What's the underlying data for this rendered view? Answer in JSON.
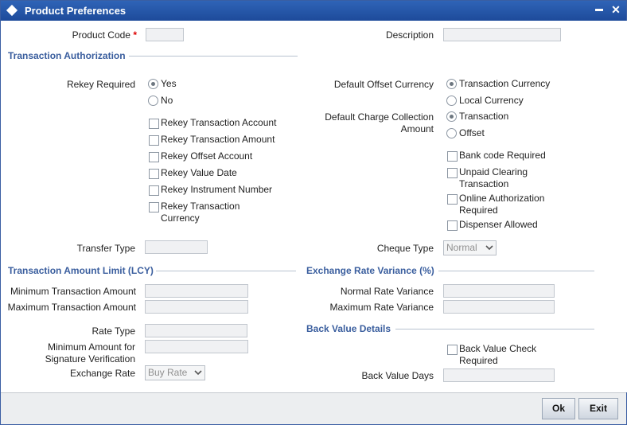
{
  "window": {
    "title": "Product Preferences",
    "minimize_glyph": "▬",
    "close_glyph": "✕"
  },
  "fields": {
    "product_code_label": "Product Code",
    "product_code_required": "*",
    "description_label": "Description",
    "transfer_type_label": "Transfer Type",
    "cheque_type_label": "Cheque Type",
    "cheque_type_value": "Normal"
  },
  "transaction_authorization": {
    "heading": "Transaction Authorization",
    "rekey_required_label": "Rekey Required",
    "rekey_yes": "Yes",
    "rekey_no": "No",
    "checkboxes": [
      "Rekey Transaction Account",
      "Rekey Transaction Amount",
      "Rekey Offset Account",
      "Rekey Value Date",
      "Rekey Instrument Number",
      "Rekey Transaction",
      "Currency"
    ]
  },
  "right_options": {
    "default_offset_currency_label": "Default Offset Currency",
    "offset_currency_options": [
      "Transaction Currency",
      "Local Currency"
    ],
    "default_charge_label_line1": "Default Charge Collection",
    "default_charge_label_line2": "Amount",
    "charge_options": [
      "Transaction",
      "Offset"
    ],
    "bank_code_required": "Bank code Required",
    "unpaid_clearing_line1": "Unpaid Clearing",
    "unpaid_clearing_line2": "Transaction",
    "online_auth_line1": "Online Authorization",
    "online_auth_line2": "Required",
    "dispenser_allowed": "Dispenser Allowed"
  },
  "amount_limit": {
    "heading": "Transaction Amount Limit (LCY)",
    "min_label": "Minimum Transaction Amount",
    "max_label": "Maximum Transaction Amount",
    "rate_type_label": "Rate Type",
    "min_sig_line1": "Minimum Amount for",
    "min_sig_line2": "Signature Verification",
    "exchange_rate_label": "Exchange Rate",
    "exchange_rate_value": "Buy Rate"
  },
  "rate_variance": {
    "heading": "Exchange Rate Variance (%)",
    "normal_label": "Normal Rate Variance",
    "max_label": "Maximum Rate Variance"
  },
  "back_value": {
    "heading": "Back Value Details",
    "check_line1": "Back Value Check",
    "check_line2": "Required",
    "days_label": "Back Value Days"
  },
  "footer": {
    "ok_label": "Ok",
    "exit_label": "Exit"
  }
}
